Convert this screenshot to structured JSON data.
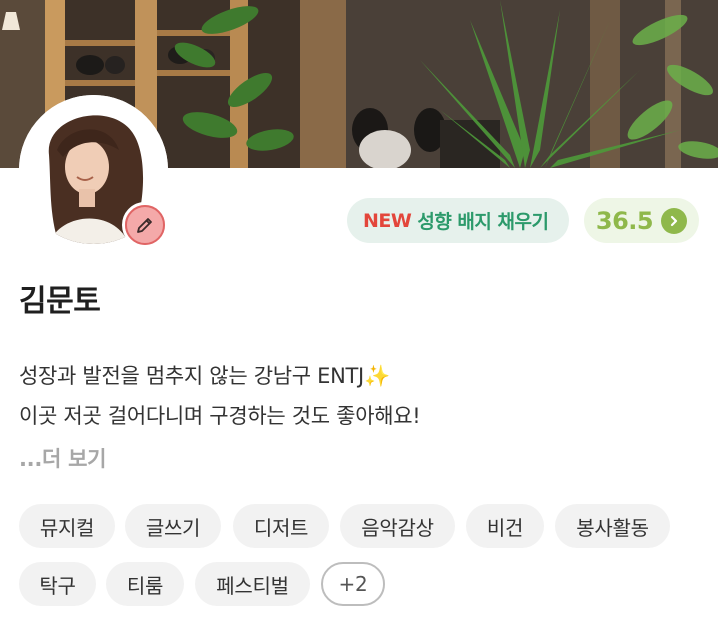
{
  "profile": {
    "name": "김문토",
    "bio_line1": "성장과 발전을 멈추지 않는 강남구 ENTJ✨",
    "bio_line2": "이곳 저곳 걸어다니며 구경하는 것도 좋아해요!",
    "more_label": "...더 보기"
  },
  "badge": {
    "new_label": "NEW",
    "text": "성향 배지 채우기"
  },
  "temperature": {
    "value": "36.5"
  },
  "tags": [
    "뮤지컬",
    "글쓰기",
    "디저트",
    "음악감상",
    "비건",
    "봉사활동",
    "탁구",
    "티룸",
    "페스티벌"
  ],
  "tags_more": "+2",
  "colors": {
    "new": "#e3463b",
    "badge_text": "#2c9a6b",
    "badge_bg": "#e6f1ec",
    "temp": "#8fb84b",
    "temp_bg": "#eef6e6",
    "edit_bg": "#f4a9a9",
    "edit_border": "#e06565",
    "tag_bg": "#f2f2f2"
  },
  "icons": {
    "edit": "pencil-icon",
    "temperature_arrow": "chevron-right-icon"
  }
}
